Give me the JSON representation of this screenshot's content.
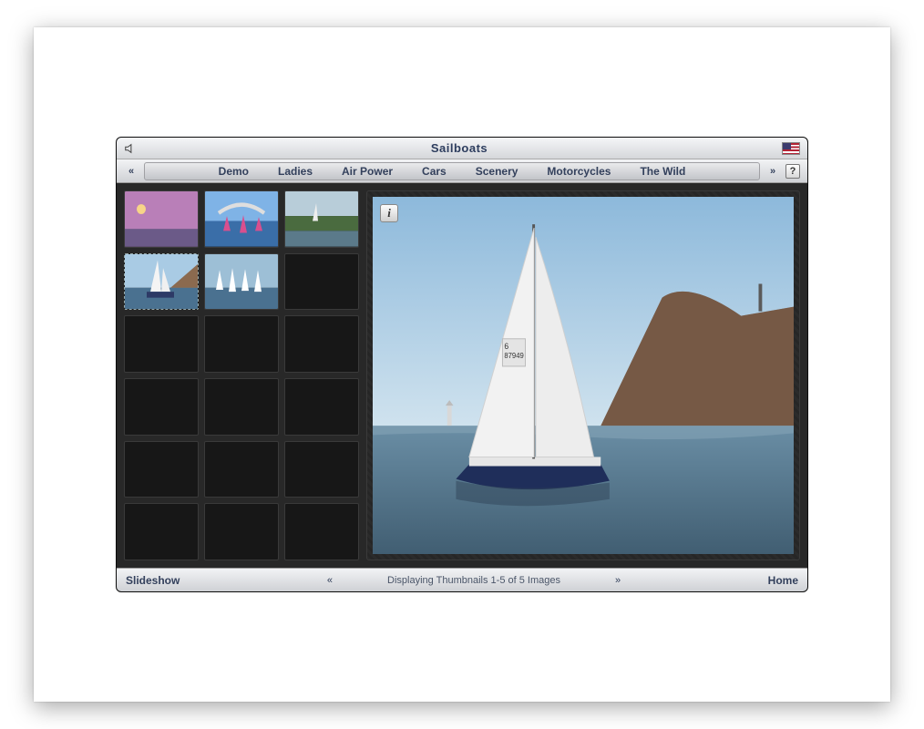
{
  "title": "Sailboats",
  "nav": {
    "tabs": [
      "Demo",
      "Ladies",
      "Air Power",
      "Cars",
      "Scenery",
      "Motorcycles",
      "The Wild"
    ]
  },
  "footer": {
    "left": "Slideshow",
    "status": "Displaying Thumbnails 1-5 of 5 Images",
    "right": "Home"
  },
  "info_label": "i",
  "help_label": "?",
  "thumbnails": {
    "count": 5,
    "selected_index": 3
  }
}
